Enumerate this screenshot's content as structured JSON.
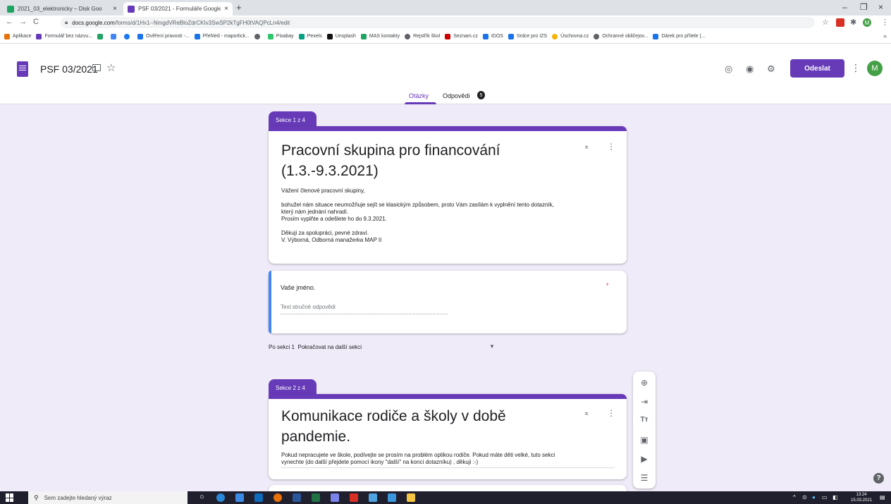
{
  "browser": {
    "tabs": [
      {
        "title": "2021_03_elektronicky – Disk Goo",
        "close": "×"
      },
      {
        "title": "PSF 03/2021 - Formuláře Google",
        "close": "×"
      }
    ],
    "new_tab": "+",
    "window_controls": {
      "minimize": "–",
      "maximize": "❐",
      "close": "×"
    },
    "nav": {
      "back": "←",
      "forward": "→",
      "reload": "C"
    },
    "url_host": "docs.google.com",
    "url_path": "/forms/d/1Hx1--NmgdVReBloZdrCKIv3SwSP2kTgFH0tVAQPcLn4/edit",
    "bookmarks": [
      {
        "label": "Aplikace",
        "color": "#e8710a"
      },
      {
        "label": "Formulář bez názvu...",
        "color": "#673ab7"
      },
      {
        "label": "",
        "color": "#1fa463"
      },
      {
        "label": "",
        "color": "#4285f4"
      },
      {
        "label": "",
        "color": "#1877f2"
      },
      {
        "label": "Ověření pravosti -...",
        "color": "#1a73e8"
      },
      {
        "label": "Přehled - maporlick...",
        "color": "#1a73e8"
      },
      {
        "label": "",
        "color": "#5f6368"
      },
      {
        "label": "Pixabay",
        "color": "#2ec66d"
      },
      {
        "label": "Pexels",
        "color": "#05a081"
      },
      {
        "label": "Unsplash",
        "color": "#111111"
      },
      {
        "label": "MAS kontakty",
        "color": "#1fa463"
      },
      {
        "label": "Rejstřík škol",
        "color": "#5f6368"
      },
      {
        "label": "Seznam.cz",
        "color": "#cc0000"
      },
      {
        "label": "IDOS",
        "color": "#1a73e8"
      },
      {
        "label": "Srdce pro IZS",
        "color": "#1a73e8"
      },
      {
        "label": "Úschovna.cz",
        "color": "#f4b400"
      },
      {
        "label": "Ochranné obličejov...",
        "color": "#5f6368"
      },
      {
        "label": "Dárek pro přítele |...",
        "color": "#1a73e8"
      }
    ],
    "bookmarks_more": "»"
  },
  "header": {
    "form_title": "PSF 03/2021",
    "send_label": "Odeslat",
    "avatar_letter": "M",
    "tabs": {
      "questions": "Otázky",
      "responses": "Odpovědi",
      "responses_count": "5"
    }
  },
  "sections": [
    {
      "label": "Sekce 1 z 4",
      "title_line1": "Pracovní skupina pro financování",
      "title_line2": "(1.3.-9.3.2021)",
      "description": [
        "Vážení členové pracovní skupiny,",
        "",
        "bohužel nám situace neumožňuje sejít se klasickým způsobem, proto Vám zasílám k vyplnění tento dotazník,",
        "který nám jednání nahradí.",
        "Prosím vyplňte a odešlete ho do 9.3.2021.",
        "",
        "Děkuji za spolupráci, pevné zdraví.",
        "V. Výborná, Odborná manažerka MAP II"
      ]
    },
    {
      "label": "Sekce 2 z 4",
      "title_line1": "Komunikace rodiče a školy v době",
      "title_line2": "pandemie.",
      "description": [
        "Pokud nepracujete ve škole, podívejte se prosím na problém optikou rodiče. Pokud máte děti velké, tuto sekci",
        "vynechte (do další přejdete pomocí ikony \"další\" na konci dotazníku) , děkuji :-)"
      ]
    }
  ],
  "question": {
    "title": "Vaše jméno.",
    "required_mark": "*",
    "placeholder": "Text stručné odpovědi"
  },
  "after_section": {
    "label": "Po sekci 1",
    "value": "Pokračovat na další sekci"
  },
  "taskbar": {
    "search_placeholder": "Sem zadejte hledaný výraz",
    "time": "13:24",
    "date": "15.03.2021"
  }
}
